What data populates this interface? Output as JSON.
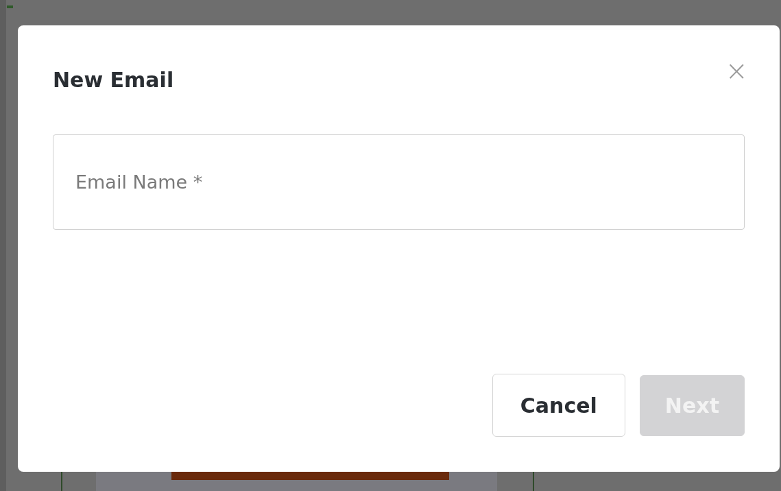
{
  "dialog": {
    "title": "New Email",
    "close": "×",
    "fields": [
      {
        "placeholder": "Email Name *"
      }
    ],
    "buttons": [
      {
        "label": "Cancel",
        "kind": "secondary",
        "disabled": false
      },
      {
        "label": "Next",
        "kind": "primary",
        "disabled": true
      }
    ]
  }
}
